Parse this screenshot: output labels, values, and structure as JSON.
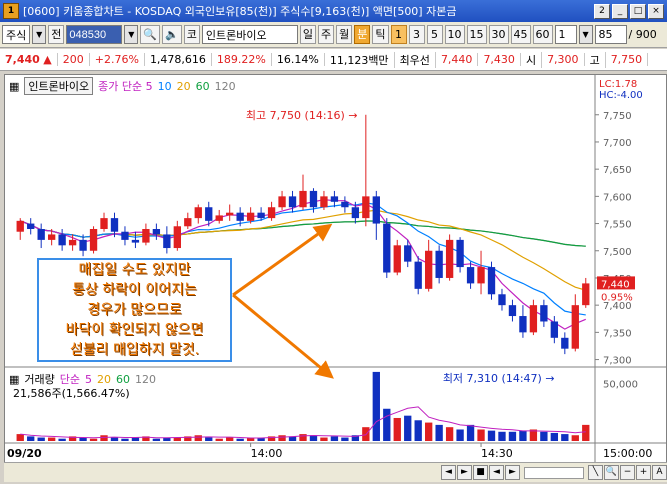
{
  "window": {
    "title": "[0600] 키움종합차트 - KOSDAQ 외국인보유[85(천)] 주식수[9,163(천)] 액면[500] 자본금",
    "title_right": "2",
    "app_badge": "1",
    "buttons": [
      "_",
      "□",
      "×"
    ]
  },
  "toolbar": {
    "market": "주식",
    "prev_label": "전",
    "code": "048530",
    "stock_badge": "코",
    "stock_name": "인트론바이오",
    "periods": [
      "일",
      "주",
      "월",
      "분",
      "틱"
    ],
    "active_period": "분",
    "intervals": [
      "1",
      "3",
      "5",
      "10",
      "15",
      "30",
      "45",
      "60",
      "1"
    ],
    "active_interval": "1",
    "count": "85",
    "count_total": "/ 900"
  },
  "quote": {
    "price": "7,440",
    "arrow": "▲",
    "change": "200",
    "change_pct": "+2.76%",
    "volume": "1,478,616",
    "vol_ratio": "189.22%",
    "turnover": "16.14%",
    "trade_value": "11,123백만",
    "best_bid_label": "최우선",
    "ask1": "7,440",
    "ask2": "7,430",
    "open_label": "시",
    "open": "7,300",
    "high_label": "고",
    "high": "7,750"
  },
  "chart_data": {
    "type": "candlestick",
    "stock": "인트론바이오",
    "interval": "1분",
    "legend": [
      "종가 단순 5",
      "10",
      "20",
      "60",
      "120"
    ],
    "legend_colors": [
      "#c020c0",
      "#0080ff",
      "#e0a000",
      "#10a040",
      "#808080"
    ],
    "price_ticks": [
      "7,750",
      "7,700",
      "7,650",
      "7,600",
      "7,550",
      "7,500",
      "7,450",
      "7,400",
      "7,350",
      "7,300"
    ],
    "lc": "LC:1.78",
    "hc": "HC:-4.00",
    "last_price_tag": "7,440",
    "last_pct_tag": "0.95%",
    "high_annotation": "최고 7,750 (14:16)",
    "low_annotation": "최저 7,310 (14:47)",
    "ylim": [
      7290,
      7790
    ],
    "candles": [
      [
        7535,
        7555,
        7520,
        7560
      ],
      [
        7550,
        7540,
        7530,
        7560
      ],
      [
        7540,
        7520,
        7505,
        7550
      ],
      [
        7520,
        7530,
        7510,
        7540
      ],
      [
        7530,
        7510,
        7500,
        7540
      ],
      [
        7510,
        7520,
        7500,
        7530
      ],
      [
        7520,
        7500,
        7490,
        7530
      ],
      [
        7500,
        7540,
        7495,
        7545
      ],
      [
        7540,
        7560,
        7535,
        7570
      ],
      [
        7560,
        7535,
        7525,
        7570
      ],
      [
        7535,
        7520,
        7510,
        7545
      ],
      [
        7520,
        7515,
        7505,
        7535
      ],
      [
        7515,
        7540,
        7510,
        7550
      ],
      [
        7540,
        7530,
        7520,
        7550
      ],
      [
        7530,
        7505,
        7495,
        7545
      ],
      [
        7505,
        7545,
        7500,
        7555
      ],
      [
        7545,
        7560,
        7540,
        7570
      ],
      [
        7560,
        7580,
        7550,
        7585
      ],
      [
        7580,
        7555,
        7545,
        7590
      ],
      [
        7555,
        7565,
        7550,
        7575
      ],
      [
        7565,
        7570,
        7555,
        7585
      ],
      [
        7570,
        7555,
        7545,
        7580
      ],
      [
        7555,
        7570,
        7550,
        7580
      ],
      [
        7570,
        7560,
        7555,
        7580
      ],
      [
        7560,
        7580,
        7555,
        7590
      ],
      [
        7580,
        7600,
        7575,
        7610
      ],
      [
        7600,
        7580,
        7570,
        7610
      ],
      [
        7580,
        7610,
        7575,
        7640
      ],
      [
        7610,
        7580,
        7570,
        7615
      ],
      [
        7580,
        7600,
        7575,
        7610
      ],
      [
        7600,
        7590,
        7580,
        7610
      ],
      [
        7590,
        7580,
        7570,
        7600
      ],
      [
        7580,
        7560,
        7550,
        7590
      ],
      [
        7560,
        7600,
        7545,
        7750
      ],
      [
        7600,
        7550,
        7520,
        7610
      ],
      [
        7550,
        7460,
        7450,
        7560
      ],
      [
        7460,
        7510,
        7455,
        7520
      ],
      [
        7510,
        7480,
        7470,
        7520
      ],
      [
        7480,
        7430,
        7420,
        7490
      ],
      [
        7430,
        7500,
        7425,
        7520
      ],
      [
        7500,
        7450,
        7440,
        7510
      ],
      [
        7450,
        7520,
        7445,
        7530
      ],
      [
        7520,
        7470,
        7460,
        7525
      ],
      [
        7470,
        7440,
        7430,
        7480
      ],
      [
        7440,
        7470,
        7420,
        7500
      ],
      [
        7470,
        7420,
        7410,
        7480
      ],
      [
        7420,
        7400,
        7390,
        7430
      ],
      [
        7400,
        7380,
        7370,
        7410
      ],
      [
        7380,
        7350,
        7340,
        7400
      ],
      [
        7350,
        7400,
        7345,
        7410
      ],
      [
        7400,
        7370,
        7360,
        7410
      ],
      [
        7370,
        7340,
        7330,
        7380
      ],
      [
        7340,
        7320,
        7310,
        7350
      ],
      [
        7320,
        7400,
        7315,
        7420
      ],
      [
        7400,
        7440,
        7395,
        7450
      ]
    ],
    "sub_legend": [
      "거래량",
      "단순",
      "5",
      "20",
      "60",
      "120"
    ],
    "sub_colors": [
      "#000000",
      "#c020c0",
      "#c020c0",
      "#e0a000",
      "#10a040",
      "#808080"
    ],
    "sub_value": "21,586주(1,566.47%)",
    "sub_tick": "50,000",
    "volumes": [
      6,
      4,
      3,
      3,
      2,
      4,
      3,
      2,
      5,
      3,
      2,
      3,
      4,
      2,
      3,
      3,
      4,
      5,
      3,
      2,
      3,
      2,
      3,
      3,
      4,
      5,
      4,
      6,
      5,
      3,
      4,
      3,
      5,
      12,
      60,
      28,
      20,
      22,
      18,
      16,
      14,
      12,
      10,
      14,
      10,
      9,
      8,
      8,
      9,
      10,
      8,
      7,
      6,
      5,
      14
    ],
    "x_labels": [
      "09/20",
      "14:00",
      "14:30",
      "15:00:00"
    ]
  },
  "annotation": {
    "lines": [
      "매집일 수도 있지만",
      "통상 하락이 이어지는",
      "경우가 많으므로",
      "바닥이 확인되지 않으면",
      "섣불리 매입하지 말것."
    ]
  },
  "scrollbar": {
    "buttons": [
      "◄",
      "►",
      "■",
      "◄",
      "►",
      "▼",
      "+"
    ]
  }
}
